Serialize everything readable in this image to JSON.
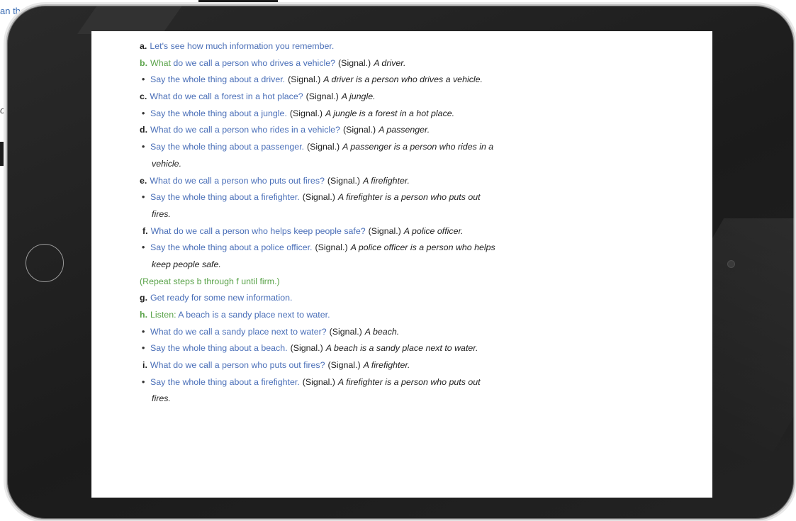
{
  "background": {
    "fragment_top": "an th",
    "fragment_mid": "o"
  },
  "lesson": {
    "a": {
      "letter": "a.",
      "text": "Let's see how much information you remember."
    },
    "b": {
      "letter": "b.",
      "lead": "What",
      "text": " do we call a person who drives a vehicle?",
      "signal": "(Signal.)",
      "answer": "A driver."
    },
    "b_bullet": {
      "text": "Say the whole thing about a driver.",
      "signal": "(Signal.)",
      "answer": "A driver is a person who drives a vehicle."
    },
    "c": {
      "letter": "c.",
      "text": "What do we call a forest in a hot place?",
      "signal": "(Signal.)",
      "answer": "A jungle."
    },
    "c_bullet": {
      "text": "Say the whole thing about a jungle.",
      "signal": "(Signal.)",
      "answer": "A jungle is a forest in a hot place."
    },
    "d": {
      "letter": "d.",
      "text": "What do we call a person who rides in a vehicle?",
      "signal": "(Signal.)",
      "answer": "A passenger."
    },
    "d_bullet": {
      "text": "Say the whole thing about a passenger.",
      "signal": "(Signal.)",
      "answer": "A passenger is a person who rides in a",
      "answer_cont": "vehicle."
    },
    "e": {
      "letter": "e.",
      "text": "What do we call a person who puts out fires?",
      "signal": "(Signal.)",
      "answer": "A firefighter."
    },
    "e_bullet": {
      "text": "Say the whole thing about a firefighter.",
      "signal": "(Signal.)",
      "answer": "A firefighter is a person who puts out",
      "answer_cont": "fires."
    },
    "f": {
      "letter": "f.",
      "text": "What do we call a person who helps keep people safe?",
      "signal": "(Signal.)",
      "answer": "A police officer."
    },
    "f_bullet": {
      "text": "Say the whole thing about a police officer.",
      "signal": "(Signal.)",
      "answer": "A police officer is a person who helps",
      "answer_cont": "keep people safe."
    },
    "repeat": "(Repeat steps b through f until firm.)",
    "g": {
      "letter": "g.",
      "text": "Get ready for some new information."
    },
    "h": {
      "letter": "h.",
      "lead": "Listen:",
      "text": " A beach is a sandy place next to water."
    },
    "h_bullet1": {
      "text": "What do we call a sandy place next to water?",
      "signal": "(Signal.)",
      "answer": "A beach."
    },
    "h_bullet2": {
      "text": "Say the whole thing about a beach.",
      "signal": "(Signal.)",
      "answer": "A beach is a sandy place next to water."
    },
    "i": {
      "letter": "i.",
      "text": "What do we call a person who puts out fires?",
      "signal": "(Signal.)",
      "answer": "A firefighter."
    },
    "i_bullet": {
      "text": "Say the whole thing about a firefighter.",
      "signal": "(Signal.)",
      "answer": "A firefighter is a person who puts out",
      "answer_cont": "fires."
    }
  },
  "colors": {
    "instruction": "#4a6fb8",
    "highlight": "#5aa34a",
    "bezel": "#1f1f1f"
  }
}
